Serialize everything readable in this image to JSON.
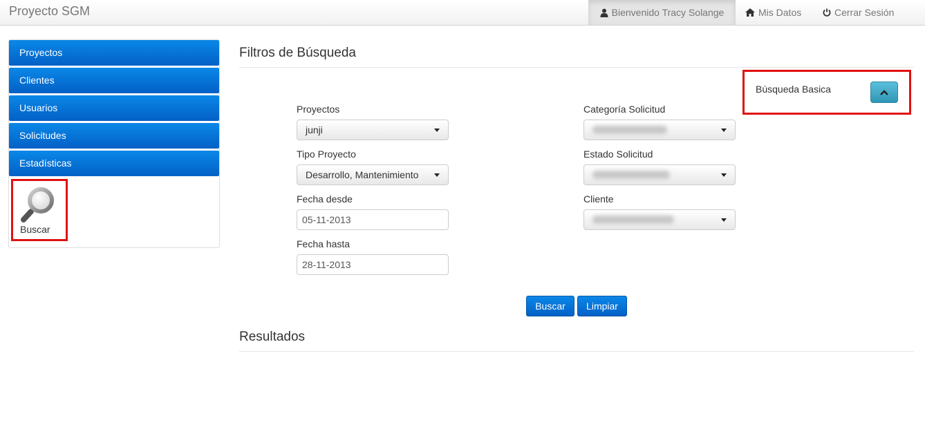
{
  "app": {
    "title": "Proyecto SGM"
  },
  "nav": {
    "welcome": "Bienvenido Tracy Solange",
    "mis_datos": "Mis Datos",
    "cerrar_sesion": "Cerrar Sesión"
  },
  "sidebar": {
    "items": [
      {
        "label": "Proyectos"
      },
      {
        "label": "Clientes"
      },
      {
        "label": "Usuarios"
      },
      {
        "label": "Solicitudes"
      },
      {
        "label": "Estadísticas"
      }
    ],
    "search_tile": {
      "label": "Buscar",
      "icon": "magnifier-icon"
    }
  },
  "filters": {
    "title": "Filtros de Búsqueda",
    "basic_search_label": "Búsqueda Basica",
    "fields": {
      "proyectos": {
        "label": "Proyectos",
        "value": "junji"
      },
      "tipo_proyecto": {
        "label": "Tipo Proyecto",
        "value": "Desarrollo, Mantenimiento"
      },
      "fecha_desde": {
        "label": "Fecha desde",
        "value": "05-11-2013"
      },
      "fecha_hasta": {
        "label": "Fecha hasta",
        "value": "28-11-2013"
      },
      "categoria_solicitud": {
        "label": "Categoría Solicitud",
        "value": ""
      },
      "estado_solicitud": {
        "label": "Estado Solicitud",
        "value": ""
      },
      "cliente": {
        "label": "Cliente",
        "value": ""
      }
    },
    "buttons": {
      "buscar": "Buscar",
      "limpiar": "Limpiar"
    }
  },
  "results": {
    "title": "Resultados"
  },
  "colors": {
    "primary": "#0360c6",
    "info": "#2f96b4",
    "highlight": "#e01010"
  }
}
